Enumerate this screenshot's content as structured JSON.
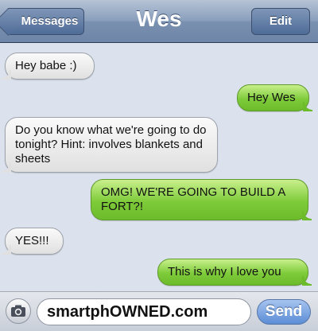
{
  "nav": {
    "back_label": "Messages",
    "title": "Wes",
    "edit_label": "Edit"
  },
  "messages": [
    {
      "from": "them",
      "text": "Hey babe :)"
    },
    {
      "from": "me",
      "text": "Hey Wes"
    },
    {
      "from": "them",
      "text": "Do you know what we're going to do tonight? Hint: involves blankets and sheets"
    },
    {
      "from": "me",
      "text": "OMG! WE'RE GOING TO BUILD A FORT?!"
    },
    {
      "from": "them",
      "text": "YES!!!"
    },
    {
      "from": "me",
      "text": "This is why I love you"
    }
  ],
  "composer": {
    "field_value": "smartphOWNED.com",
    "send_label": "Send",
    "camera_icon": "camera-icon"
  },
  "colors": {
    "incoming_bubble": "#e6e6e6",
    "outgoing_bubble": "#7ecb3a",
    "nav_bar": "#7a90b0",
    "background": "#dbe2ed",
    "send_button": "#5b8dd6"
  }
}
